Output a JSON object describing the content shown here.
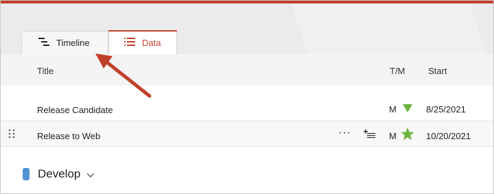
{
  "colors": {
    "accent": "#c0402a",
    "milestone_green": "#6db33f",
    "group_color": "#4f94d4",
    "annotation_arrow": "#c0402a"
  },
  "tabs": [
    {
      "label": "Timeline",
      "icon": "timeline-icon",
      "active": false
    },
    {
      "label": "Data",
      "icon": "list-icon",
      "active": true
    }
  ],
  "table": {
    "columns": {
      "title": "Title",
      "tm": "T/M",
      "start": "Start"
    },
    "rows": [
      {
        "title": "Release Candidate",
        "tm": "M",
        "marker": "triangle-down-icon",
        "start": "8/25/2021"
      },
      {
        "title": "Release to Web",
        "tm": "M",
        "marker": "star-icon",
        "start": "10/20/2021",
        "more_label": "···"
      }
    ]
  },
  "group": {
    "label": "Develop",
    "icon": "chevron-down-icon"
  }
}
